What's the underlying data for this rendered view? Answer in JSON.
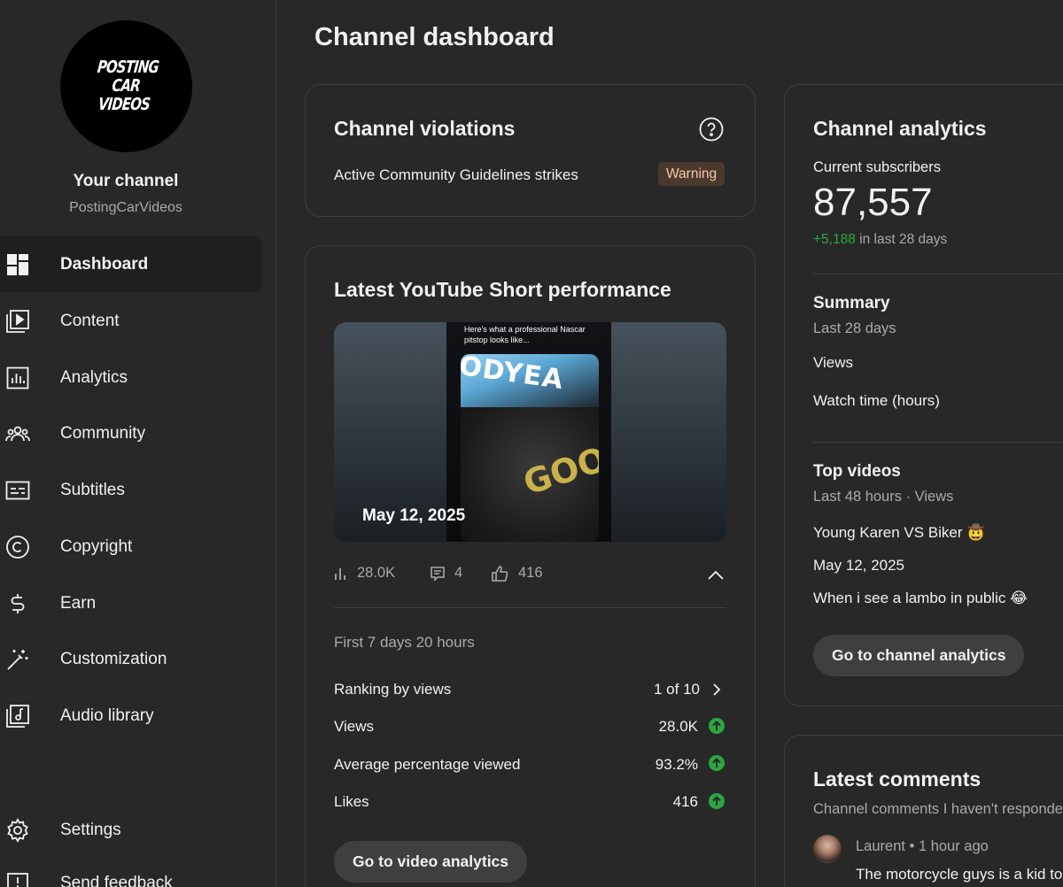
{
  "sidebar": {
    "avatar_text": "POSTING\nCAR\nVIDEOS",
    "channel_title": "Your channel",
    "channel_handle": "PostingCarVideos",
    "items": [
      {
        "label": "Dashboard",
        "icon": "dashboard-icon",
        "active": true
      },
      {
        "label": "Content",
        "icon": "content-icon"
      },
      {
        "label": "Analytics",
        "icon": "analytics-icon"
      },
      {
        "label": "Community",
        "icon": "community-icon"
      },
      {
        "label": "Subtitles",
        "icon": "subtitles-icon"
      },
      {
        "label": "Copyright",
        "icon": "copyright-icon"
      },
      {
        "label": "Earn",
        "icon": "earn-icon"
      },
      {
        "label": "Customization",
        "icon": "customization-icon"
      },
      {
        "label": "Audio library",
        "icon": "audio-library-icon"
      }
    ],
    "bottom_items": [
      {
        "label": "Settings",
        "icon": "settings-icon"
      },
      {
        "label": "Send feedback",
        "icon": "feedback-icon"
      }
    ]
  },
  "page": {
    "title": "Channel dashboard"
  },
  "violations": {
    "title": "Channel violations",
    "strikes_label": "Active Community Guidelines strikes",
    "status_badge": "Warning"
  },
  "short_performance": {
    "title": "Latest YouTube Short performance",
    "thumbnail_caption": "Here's what a professional Nascar pitstop looks like...",
    "thumbnail_text_1": "ODYEA",
    "thumbnail_text_2": "GOO",
    "date": "May 12, 2025",
    "stats": {
      "views": "28.0K",
      "comments": "4",
      "likes": "416"
    },
    "period": "First 7 days 20 hours",
    "metrics": [
      {
        "label": "Ranking by views",
        "value": "1 of 10"
      },
      {
        "label": "Views",
        "value": "28.0K"
      },
      {
        "label": "Average percentage viewed",
        "value": "93.2%"
      },
      {
        "label": "Likes",
        "value": "416"
      }
    ],
    "button": "Go to video analytics"
  },
  "analytics": {
    "title": "Channel analytics",
    "subscribers_label": "Current subscribers",
    "subscribers": "87,557",
    "change": "+5,188",
    "change_suffix": "in last 28 days",
    "summary_title": "Summary",
    "summary_period": "Last 28 days",
    "summary_items": [
      "Views",
      "Watch time (hours)"
    ],
    "top_videos_title": "Top videos",
    "top_videos_period": "Last 48 hours · Views",
    "top_videos": [
      "Young Karen VS Biker 🤠",
      "May 12, 2025",
      "When i see a lambo in public 😂"
    ],
    "button": "Go to channel analytics"
  },
  "comments": {
    "title": "Latest comments",
    "subtitle": "Channel comments I haven't responded to",
    "items": [
      {
        "author": "Laurent",
        "time": "1 hour ago",
        "separator": "•",
        "text": "The motorcycle guys is a kid to"
      }
    ]
  },
  "colors": {
    "background": "#282828",
    "accent_green": "#2ba640",
    "warning_bg": "#4a3a2e",
    "warning_text": "#f7c8a6",
    "button_bg": "#3f3f3f"
  }
}
